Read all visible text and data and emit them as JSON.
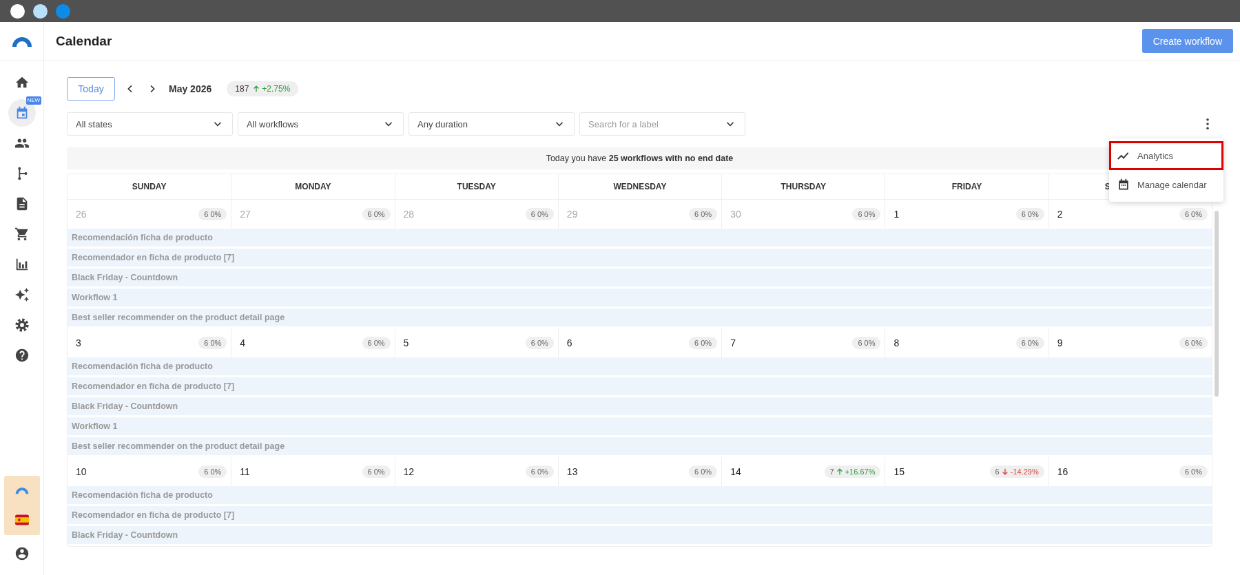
{
  "window": {
    "controls": [
      {
        "color": "#ffffff"
      },
      {
        "color": "#b9e0fa"
      },
      {
        "color": "#0a8ce8"
      }
    ]
  },
  "sidebar": {
    "items": [
      {
        "kind": "home",
        "selected": false
      },
      {
        "kind": "calendar",
        "selected": true,
        "badge": "NEW"
      },
      {
        "kind": "people",
        "selected": false
      },
      {
        "kind": "flow",
        "selected": false
      },
      {
        "kind": "document",
        "selected": false
      },
      {
        "kind": "cart",
        "selected": false
      },
      {
        "kind": "chart",
        "selected": false
      },
      {
        "kind": "sparkles",
        "selected": false
      },
      {
        "kind": "settings",
        "selected": false
      },
      {
        "kind": "help",
        "selected": false
      }
    ]
  },
  "header": {
    "title": "Calendar",
    "button": "Create workflow"
  },
  "toolbar": {
    "today": "Today",
    "month": "May 2026",
    "total": {
      "count": "187",
      "change": "+2.75%",
      "rising": true,
      "falling": false
    }
  },
  "filters": [
    {
      "value": "All states"
    },
    {
      "value": "All workflows"
    },
    {
      "value": "Any duration"
    },
    {
      "placeholder": "Search for a label"
    }
  ],
  "banner": "Today you have **25 workflows with no end date**",
  "menu": {
    "items": [
      {
        "kind": "analytics",
        "label": "Analytics",
        "highlighted": true
      },
      {
        "kind": "calendar",
        "label": "Manage calendar",
        "highlighted": false
      }
    ]
  },
  "calendar": {
    "weekdays": [
      "SUNDAY",
      "MONDAY",
      "TUESDAY",
      "WEDNESDAY",
      "THURSDAY",
      "FRIDAY",
      "S"
    ],
    "weeks": [
      {
        "days": [
          {
            "day": "26",
            "muted": true,
            "count": "6",
            "change": "0%",
            "rising": false,
            "falling": false
          },
          {
            "day": "27",
            "muted": true,
            "count": "6",
            "change": "0%",
            "rising": false,
            "falling": false
          },
          {
            "day": "28",
            "muted": true,
            "count": "6",
            "change": "0%",
            "rising": false,
            "falling": false
          },
          {
            "day": "29",
            "muted": true,
            "count": "6",
            "change": "0%",
            "rising": false,
            "falling": false
          },
          {
            "day": "30",
            "muted": true,
            "count": "6",
            "change": "0%",
            "rising": false,
            "falling": false
          },
          {
            "day": "1",
            "muted": false,
            "count": "6",
            "change": "0%",
            "rising": false,
            "falling": false
          },
          {
            "day": "2",
            "muted": false,
            "count": "6",
            "change": "0%",
            "rising": false,
            "falling": false
          }
        ],
        "events": [
          "Recomendación ficha de producto",
          "Recomendador en ficha de producto [7]",
          "Black Friday - Countdown",
          "Workflow 1",
          "Best seller recommender on the product detail page"
        ]
      },
      {
        "days": [
          {
            "day": "3",
            "muted": false,
            "count": "6",
            "change": "0%",
            "rising": false,
            "falling": false
          },
          {
            "day": "4",
            "muted": false,
            "count": "6",
            "change": "0%",
            "rising": false,
            "falling": false
          },
          {
            "day": "5",
            "muted": false,
            "count": "6",
            "change": "0%",
            "rising": false,
            "falling": false
          },
          {
            "day": "6",
            "muted": false,
            "count": "6",
            "change": "0%",
            "rising": false,
            "falling": false
          },
          {
            "day": "7",
            "muted": false,
            "count": "6",
            "change": "0%",
            "rising": false,
            "falling": false
          },
          {
            "day": "8",
            "muted": false,
            "count": "6",
            "change": "0%",
            "rising": false,
            "falling": false
          },
          {
            "day": "9",
            "muted": false,
            "count": "6",
            "change": "0%",
            "rising": false,
            "falling": false
          }
        ],
        "events": [
          "Recomendación ficha de producto",
          "Recomendador en ficha de producto [7]",
          "Black Friday - Countdown",
          "Workflow 1",
          "Best seller recommender on the product detail page"
        ]
      },
      {
        "days": [
          {
            "day": "10",
            "muted": false,
            "count": "6",
            "change": "0%",
            "rising": false,
            "falling": false
          },
          {
            "day": "11",
            "muted": false,
            "count": "6",
            "change": "0%",
            "rising": false,
            "falling": false
          },
          {
            "day": "12",
            "muted": false,
            "count": "6",
            "change": "0%",
            "rising": false,
            "falling": false
          },
          {
            "day": "13",
            "muted": false,
            "count": "6",
            "change": "0%",
            "rising": false,
            "falling": false
          },
          {
            "day": "14",
            "muted": false,
            "count": "7",
            "change": "+16.67%",
            "rising": true,
            "falling": false
          },
          {
            "day": "15",
            "muted": false,
            "count": "6",
            "change": "-14.29%",
            "rising": false,
            "falling": true
          },
          {
            "day": "16",
            "muted": false,
            "count": "6",
            "change": "0%",
            "rising": false,
            "falling": false
          }
        ],
        "events": [
          "Recomendación ficha de producto",
          "Recomendador en ficha de producto [7]",
          "Black Friday - Countdown"
        ]
      }
    ]
  }
}
